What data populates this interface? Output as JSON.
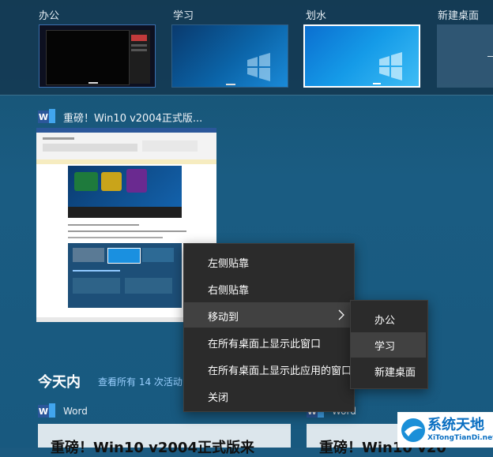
{
  "desktops": [
    {
      "label": "办公"
    },
    {
      "label": "学习"
    },
    {
      "label": "划水"
    },
    {
      "label": "新建桌面"
    }
  ],
  "window": {
    "app_letter": "W",
    "title": "重磅！Win10 v2004正式版..."
  },
  "context_menu": {
    "items": [
      {
        "label": "左侧贴靠"
      },
      {
        "label": "右侧贴靠"
      },
      {
        "label": "移动到"
      },
      {
        "label": "在所有桌面上显示此窗口"
      },
      {
        "label": "在所有桌面上显示此应用的窗口"
      },
      {
        "label": "关闭"
      }
    ]
  },
  "submenu": {
    "items": [
      {
        "label": "办公"
      },
      {
        "label": "学习"
      },
      {
        "label": "新建桌面"
      }
    ]
  },
  "timeline": {
    "heading": "今天内",
    "link": "查看所有 14 次活动",
    "cards": [
      {
        "app": "Word",
        "title": "重磅！Win10 v2004正式版来"
      },
      {
        "app": "Word",
        "title": "重磅！Win10 v20"
      }
    ]
  },
  "watermark": {
    "name": "系统天地",
    "url": "XiTongTianDi.net"
  },
  "colors": {
    "background": "#1b5a80",
    "menu_bg": "#2b2b2b",
    "menu_highlight": "#414141",
    "link": "#9ad0ff",
    "word_blue": "#2b579a"
  }
}
